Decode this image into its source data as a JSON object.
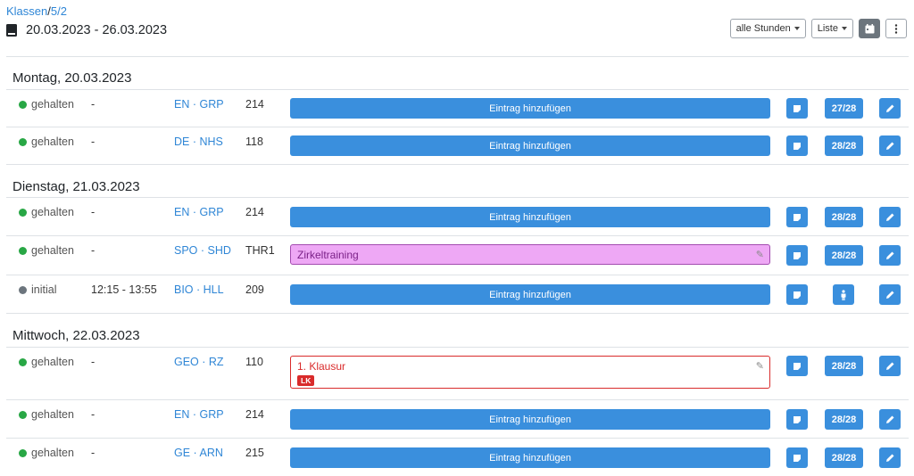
{
  "breadcrumb": {
    "parent": "Klassen",
    "separator": "/",
    "current": "5/2"
  },
  "week": {
    "range": "20.03.2023 - 26.03.2023"
  },
  "toolbar": {
    "hours_filter": "alle Stunden",
    "view_mode": "Liste"
  },
  "colors": {
    "accent": "#3a8fdd",
    "status_held": "#28a745",
    "status_initial": "#6c757d",
    "exam": "#d92b2b",
    "pink_entry": "#eea8f5"
  },
  "days": [
    {
      "label": "Montag, 20.03.2023",
      "lessons": [
        {
          "status": "gehalten",
          "time": "-",
          "subject": "EN · GRP",
          "room": "214",
          "entry": "Eintrag hinzufügen",
          "attendance": "27/28"
        },
        {
          "status": "gehalten",
          "time": "-",
          "subject": "DE · NHS",
          "room": "118",
          "entry": "Eintrag hinzufügen",
          "attendance": "28/28"
        }
      ]
    },
    {
      "label": "Dienstag, 21.03.2023",
      "lessons": [
        {
          "status": "gehalten",
          "time": "-",
          "subject": "EN · GRP",
          "room": "214",
          "entry": "Eintrag hinzufügen",
          "attendance": "28/28"
        },
        {
          "status": "gehalten",
          "time": "-",
          "subject": "SPO · SHD",
          "room": "THR1",
          "entry": "Zirkeltraining",
          "attendance": "28/28"
        },
        {
          "status": "initial",
          "time": "12:15 - 13:55",
          "subject": "BIO · HLL",
          "room": "209",
          "entry": "Eintrag hinzufügen",
          "attendance": ""
        }
      ]
    },
    {
      "label": "Mittwoch, 22.03.2023",
      "lessons": [
        {
          "status": "gehalten",
          "time": "-",
          "subject": "GEO · RZ",
          "room": "110",
          "entry": "1. Klausur",
          "badge": "LK",
          "attendance": "28/28"
        },
        {
          "status": "gehalten",
          "time": "-",
          "subject": "EN · GRP",
          "room": "214",
          "entry": "Eintrag hinzufügen",
          "attendance": "28/28"
        },
        {
          "status": "gehalten",
          "time": "-",
          "subject": "GE · ARN",
          "room": "215",
          "entry": "Eintrag hinzufügen",
          "attendance": "28/28"
        }
      ]
    }
  ]
}
